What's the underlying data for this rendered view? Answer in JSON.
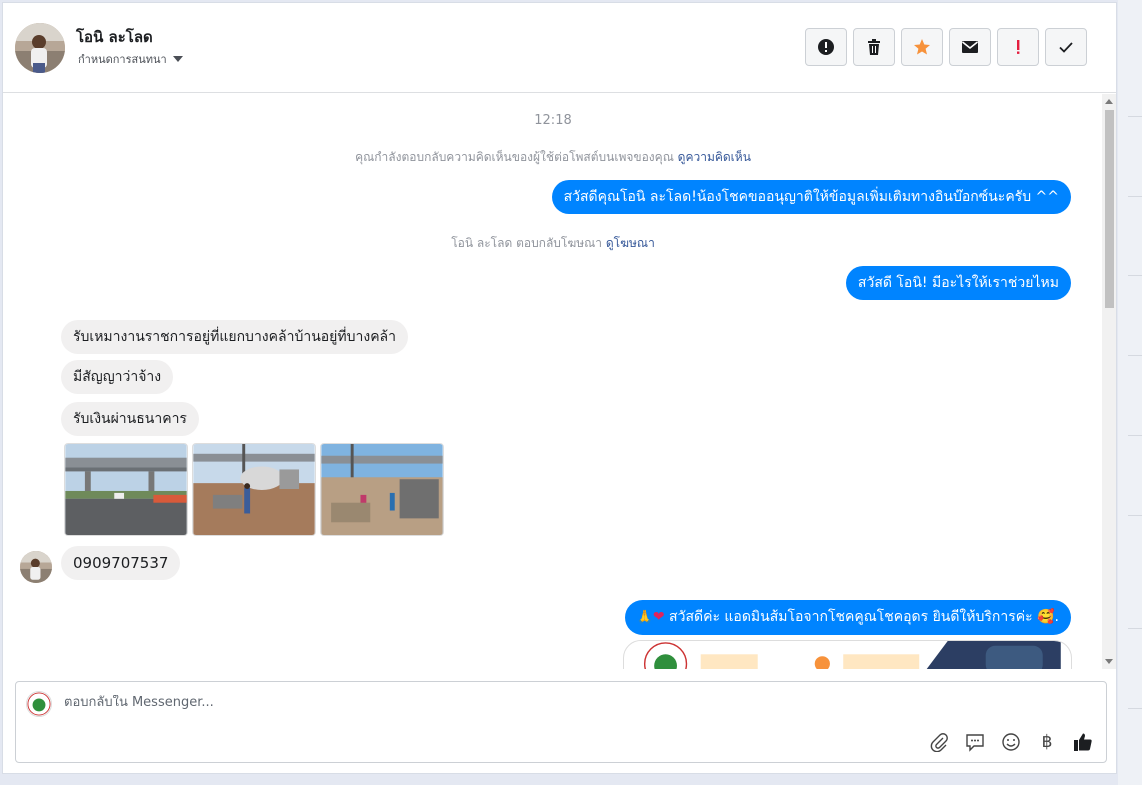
{
  "header": {
    "contact_name": "โอนิ ละโลด",
    "assign_label": "กำหนดการสนทนา"
  },
  "actions": [
    {
      "name": "spam",
      "icon": "alert-circle-icon"
    },
    {
      "name": "delete",
      "icon": "trash-icon"
    },
    {
      "name": "star",
      "icon": "star-icon"
    },
    {
      "name": "mark-unread",
      "icon": "envelope-icon"
    },
    {
      "name": "follow-up",
      "icon": "exclamation-icon"
    },
    {
      "name": "done",
      "icon": "check-icon"
    }
  ],
  "chat": {
    "timestamp": "12:18",
    "sys_comment": {
      "text": "คุณกำลังตอบกลับความคิดเห็นของผู้ใช้ต่อโพสต์บนเพจของคุณ ",
      "link": "ดูความคิดเห็น"
    },
    "msg_out_1": "สวัสดีคุณโอนิ ละโลด!น้องโชคขออนุญาติให้ข้อมูลเพิ่มเติมทางอินบ๊อกซ์นะครับ ^^",
    "sys_ad": {
      "text": "โอนิ ละโลด ตอบกลับโฆษณา ",
      "link": "ดูโฆษณา"
    },
    "msg_out_2": "สวัสดี โอนิ! มีอะไรให้เราช่วยไหม",
    "msg_in_1": "รับเหมางานราชการอยู่ที่แยกบางคล้าบ้านอยู่ที่บางคล้า",
    "msg_in_2": "มีสัญญาว่าจ้าง",
    "msg_in_3": "รับเงินผ่านธนาคาร",
    "msg_in_phone": "0909707537",
    "msg_out_3": "สวัสดีค่ะ แอดมินส้มโอจากโชคคูณโชคอุดร ยินดีให้บริการค่ะ",
    "msg_out_3_suffix": "."
  },
  "composer": {
    "placeholder": "ตอบกลับใน Messenger...",
    "baht_symbol": "฿"
  },
  "colors": {
    "outgoing": "#0084ff",
    "incoming": "#f1f0f0",
    "link": "#365899",
    "star": "#f7923b",
    "follow_up": "#e41e3f"
  }
}
